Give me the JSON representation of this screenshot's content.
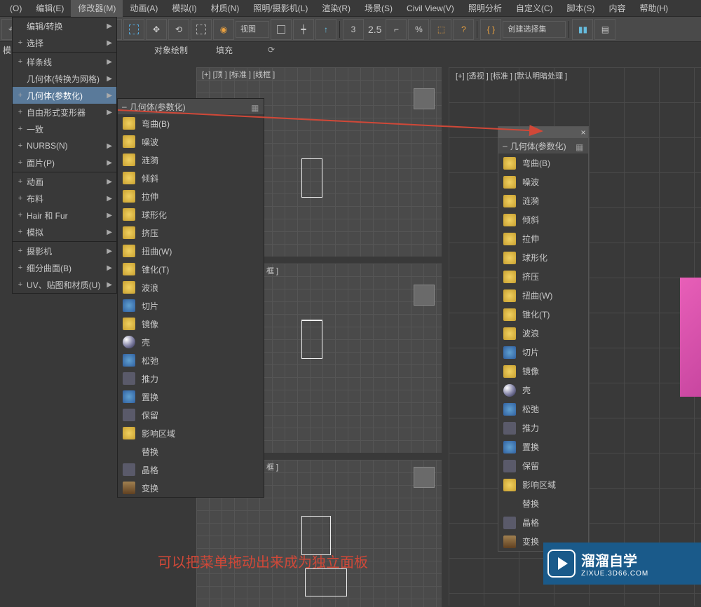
{
  "menubar": [
    "(O)",
    "编辑(E)",
    "修改器(M)",
    "动画(A)",
    "模拟(I)",
    "材质(N)",
    "照明/摄影机(L)",
    "渲染(R)",
    "场景(S)",
    "Civil View(V)",
    "照明分析",
    "自定义(C)",
    "脚本(S)",
    "内容",
    "帮助(H)"
  ],
  "menubar_active_index": 2,
  "toolbar": {
    "view_dropdown": "视图",
    "numeric": "2.5",
    "selset": "创建选择集"
  },
  "secondary_row": {
    "left_label": "模",
    "item1": "对象绘制",
    "item2": "填充"
  },
  "dropdown": {
    "items": [
      {
        "label": "编辑/转换",
        "plus": "",
        "arrow": true
      },
      {
        "label": "选择",
        "plus": "+",
        "arrow": true
      },
      {
        "sep": true
      },
      {
        "label": "样条线",
        "plus": "+",
        "arrow": true
      },
      {
        "label": "几何体(转换为网格)",
        "plus": "",
        "arrow": true
      },
      {
        "label": "几何体(参数化)",
        "plus": "+",
        "arrow": true,
        "hl": true
      },
      {
        "label": "自由形式变形器",
        "plus": "+",
        "arrow": true
      },
      {
        "label": "一致",
        "plus": "+",
        "arrow": false
      },
      {
        "label": "NURBS(N)",
        "plus": "+",
        "arrow": true
      },
      {
        "label": "面片(P)",
        "plus": "+",
        "arrow": true
      },
      {
        "sep": true
      },
      {
        "label": "动画",
        "plus": "+",
        "arrow": true
      },
      {
        "label": "布料",
        "plus": "+",
        "arrow": true
      },
      {
        "label": "Hair 和 Fur",
        "plus": "+",
        "arrow": true
      },
      {
        "label": "模拟",
        "plus": "+",
        "arrow": true
      },
      {
        "sep": true
      },
      {
        "label": "摄影机",
        "plus": "+",
        "arrow": true
      },
      {
        "label": "细分曲面(B)",
        "plus": "+",
        "arrow": true
      },
      {
        "label": "UV、贴图和材质(U)",
        "plus": "+",
        "arrow": true
      }
    ]
  },
  "submenu": {
    "title": "几何体(参数化)",
    "items": [
      {
        "label": "弯曲(B)",
        "ico": "y"
      },
      {
        "label": "噪波",
        "ico": "y"
      },
      {
        "label": "涟漪",
        "ico": "y"
      },
      {
        "label": "倾斜",
        "ico": "y"
      },
      {
        "label": "拉伸",
        "ico": "y"
      },
      {
        "label": "球形化",
        "ico": "y"
      },
      {
        "label": "挤压",
        "ico": "y"
      },
      {
        "label": "扭曲(W)",
        "ico": "y"
      },
      {
        "label": "锥化(T)",
        "ico": "y"
      },
      {
        "label": "波浪",
        "ico": "y"
      },
      {
        "label": "切片",
        "ico": "b"
      },
      {
        "label": "镜像",
        "ico": "y"
      },
      {
        "label": "壳",
        "ico": "sphere"
      },
      {
        "label": "松弛",
        "ico": "b"
      },
      {
        "label": "推力",
        "ico": "dk"
      },
      {
        "label": "置换",
        "ico": "b"
      },
      {
        "label": "保留",
        "ico": "dk"
      },
      {
        "label": "影响区域",
        "ico": "y"
      },
      {
        "label": "替换",
        "ico": ""
      },
      {
        "label": "晶格",
        "ico": "dk"
      },
      {
        "label": "变换",
        "ico": "br"
      }
    ]
  },
  "tearoff": {
    "title": "几何体(参数化)",
    "items": [
      {
        "label": "弯曲(B)",
        "ico": "y"
      },
      {
        "label": "噪波",
        "ico": "y"
      },
      {
        "label": "涟漪",
        "ico": "y"
      },
      {
        "label": "倾斜",
        "ico": "y"
      },
      {
        "label": "拉伸",
        "ico": "y"
      },
      {
        "label": "球形化",
        "ico": "y"
      },
      {
        "label": "挤压",
        "ico": "y"
      },
      {
        "label": "扭曲(W)",
        "ico": "y"
      },
      {
        "label": "锥化(T)",
        "ico": "y"
      },
      {
        "label": "波浪",
        "ico": "y"
      },
      {
        "label": "切片",
        "ico": "b"
      },
      {
        "label": "镜像",
        "ico": "y"
      },
      {
        "label": "壳",
        "ico": "sphere"
      },
      {
        "label": "松弛",
        "ico": "b"
      },
      {
        "label": "推力",
        "ico": "dk"
      },
      {
        "label": "置换",
        "ico": "b"
      },
      {
        "label": "保留",
        "ico": "dk"
      },
      {
        "label": "影响区域",
        "ico": "y"
      },
      {
        "label": "替换",
        "ico": ""
      },
      {
        "label": "晶格",
        "ico": "dk"
      },
      {
        "label": "变换",
        "ico": "br"
      }
    ]
  },
  "viewports": {
    "top_label": "[+] [顶 ] [标准 ] [线框 ]",
    "mid_label": "框 ]",
    "persp_label": "[+] [透视 ] [标准 ] [默认明暗处理 ]"
  },
  "annotation": "可以把菜单拖动出来成为独立面板",
  "logo": {
    "main": "溜溜自学",
    "sub": "ZIXUE.3D66.COM"
  }
}
